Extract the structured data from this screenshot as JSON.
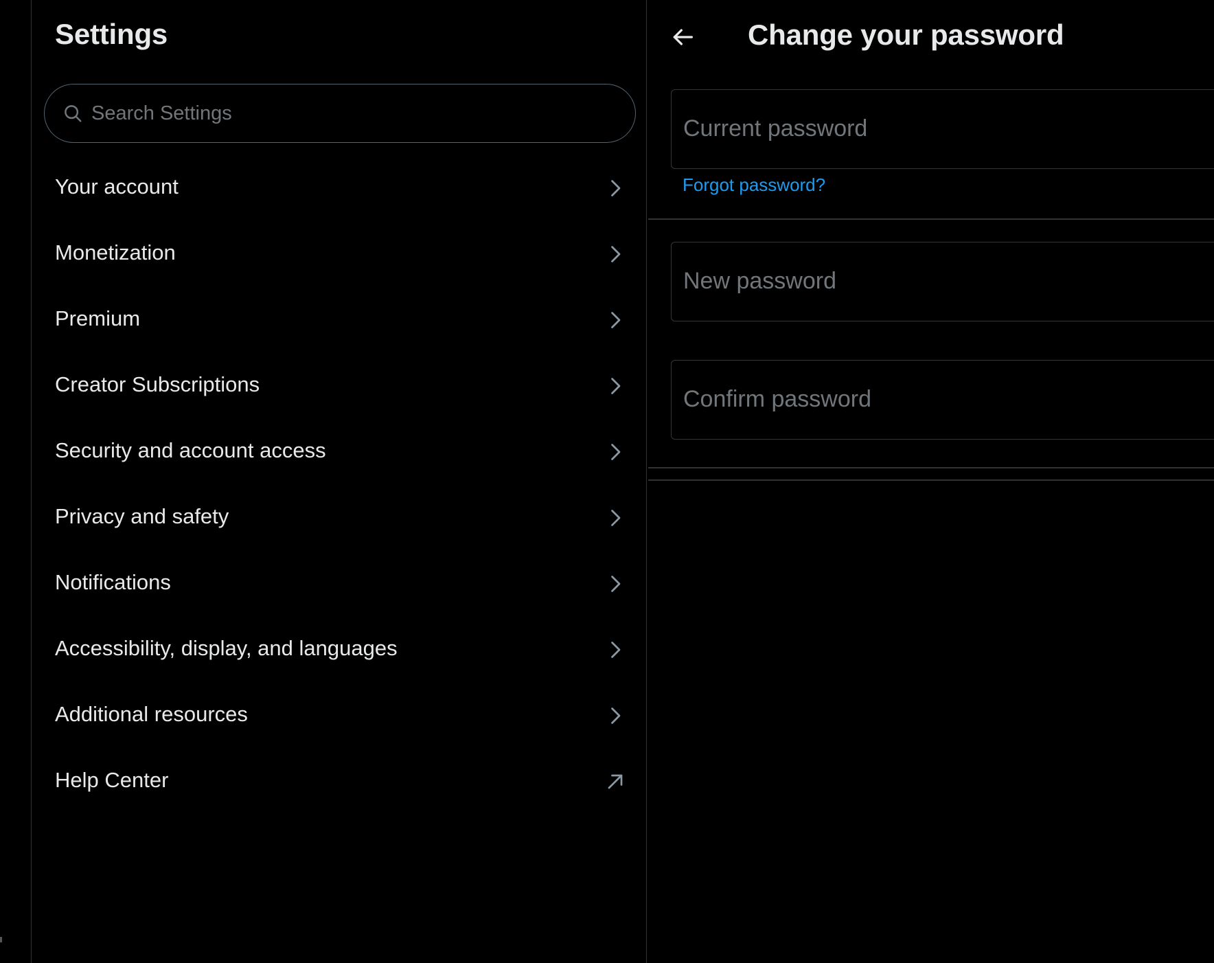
{
  "settings": {
    "title": "Settings",
    "search": {
      "placeholder": "Search Settings",
      "value": ""
    },
    "items": [
      {
        "label": "Your account",
        "icon": "chevron-right-icon"
      },
      {
        "label": "Monetization",
        "icon": "chevron-right-icon"
      },
      {
        "label": "Premium",
        "icon": "chevron-right-icon"
      },
      {
        "label": "Creator Subscriptions",
        "icon": "chevron-right-icon"
      },
      {
        "label": "Security and account access",
        "icon": "chevron-right-icon"
      },
      {
        "label": "Privacy and safety",
        "icon": "chevron-right-icon"
      },
      {
        "label": "Notifications",
        "icon": "chevron-right-icon"
      },
      {
        "label": "Accessibility, display, and languages",
        "icon": "chevron-right-icon"
      },
      {
        "label": "Additional resources",
        "icon": "chevron-right-icon"
      },
      {
        "label": "Help Center",
        "icon": "external-link-icon"
      }
    ]
  },
  "change_password": {
    "title": "Change your password",
    "current_password": {
      "placeholder": "Current password",
      "value": ""
    },
    "forgot_link": "Forgot password?",
    "new_password": {
      "placeholder": "New password",
      "value": ""
    },
    "confirm_password": {
      "placeholder": "Confirm password",
      "value": ""
    }
  },
  "colors": {
    "background": "#000000",
    "text": "#e7e9ea",
    "muted": "#71767b",
    "link": "#1d9bf0",
    "border": "#2f3336"
  }
}
